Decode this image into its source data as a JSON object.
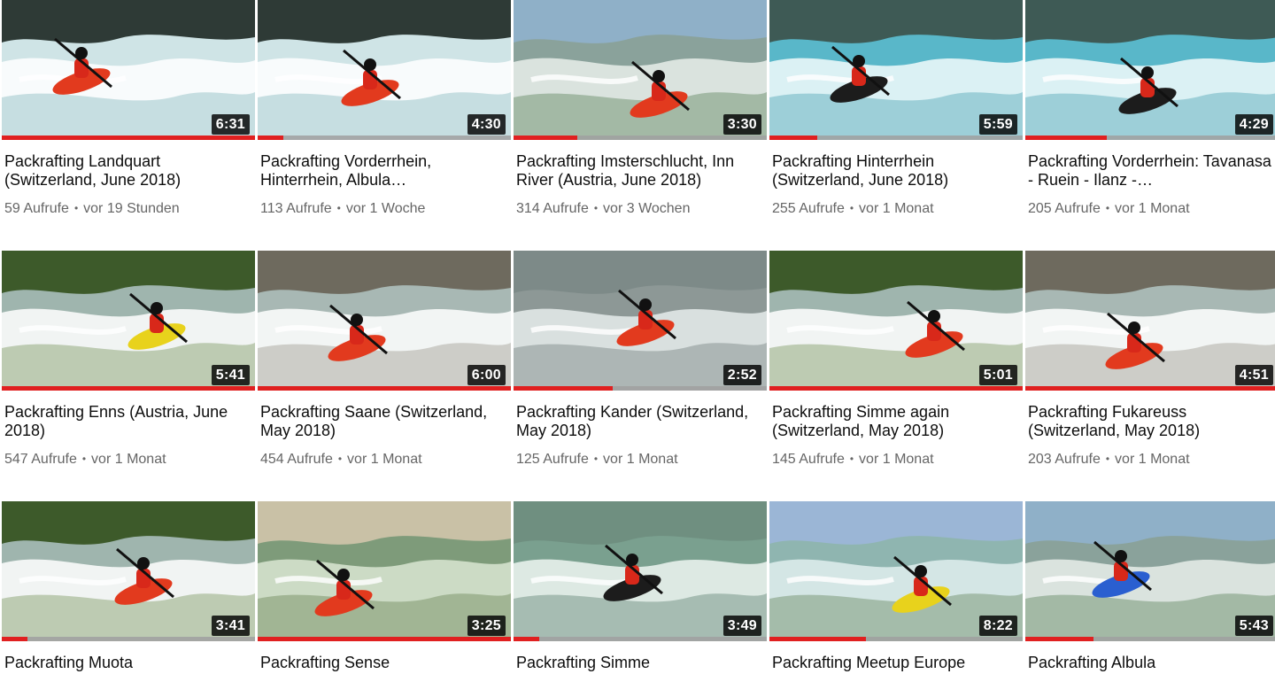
{
  "colors": {
    "progress": "#e02020",
    "track": "#a0a0a0",
    "meta": "#666666",
    "title": "#0d0d0d"
  },
  "videos": [
    {
      "title": "Packrafting Landquart (Switzerland, June 2018)",
      "views": "59 Aufrufe",
      "age": "vor 19 Stunden",
      "duration": "6:31",
      "watched": 1.0,
      "scene": "white",
      "boat": "red"
    },
    {
      "title": "Packrafting Vorderrhein, Hinterrhein, Albula…",
      "views": "113 Aufrufe",
      "age": "vor 1 Woche",
      "duration": "4:30",
      "watched": 0.1,
      "scene": "white",
      "boat": "red"
    },
    {
      "title": "Packrafting Imsterschlucht, Inn River (Austria, June 2018)",
      "views": "314 Aufrufe",
      "age": "vor 3 Wochen",
      "duration": "3:30",
      "watched": 0.25,
      "scene": "valley",
      "boat": "red"
    },
    {
      "title": "Packrafting Hinterrhein (Switzerland, June 2018)",
      "views": "255 Aufrufe",
      "age": "vor 1 Monat",
      "duration": "5:59",
      "watched": 0.19,
      "scene": "turquoise",
      "boat": "black"
    },
    {
      "title": "Packrafting Vorderrhein: Tavanasa - Ruein - Ilanz -…",
      "views": "205 Aufrufe",
      "age": "vor 1 Monat",
      "duration": "4:29",
      "watched": 0.32,
      "scene": "turquoise",
      "boat": "black"
    },
    {
      "title": "Packrafting Enns (Austria, June 2018)",
      "views": "547 Aufrufe",
      "age": "vor 1 Monat",
      "duration": "5:41",
      "watched": 1.0,
      "scene": "forest",
      "boat": "yellow"
    },
    {
      "title": "Packrafting Saane (Switzerland, May 2018)",
      "views": "454 Aufrufe",
      "age": "vor 1 Monat",
      "duration": "6:00",
      "watched": 1.0,
      "scene": "rock",
      "boat": "red"
    },
    {
      "title": "Packrafting Kander (Switzerland, May 2018)",
      "views": "125 Aufrufe",
      "age": "vor 1 Monat",
      "duration": "2:52",
      "watched": 0.39,
      "scene": "grey",
      "boat": "red"
    },
    {
      "title": "Packrafting Simme again (Switzerland, May 2018)",
      "views": "145 Aufrufe",
      "age": "vor 1 Monat",
      "duration": "5:01",
      "watched": 1.0,
      "scene": "forest",
      "boat": "red"
    },
    {
      "title": "Packrafting Fukareuss (Switzerland, May 2018)",
      "views": "203 Aufrufe",
      "age": "vor 1 Monat",
      "duration": "4:51",
      "watched": 1.0,
      "scene": "rock",
      "boat": "red"
    },
    {
      "title": "Packrafting Muota",
      "views": "",
      "age": "",
      "duration": "3:41",
      "watched": 0.1,
      "scene": "forest",
      "boat": "red"
    },
    {
      "title": "Packrafting Sense",
      "views": "",
      "age": "",
      "duration": "3:25",
      "watched": 1.0,
      "scene": "canyon",
      "boat": "red"
    },
    {
      "title": "Packrafting Simme",
      "views": "",
      "age": "",
      "duration": "3:49",
      "watched": 0.1,
      "scene": "green",
      "boat": "black"
    },
    {
      "title": "Packrafting Meetup Europe",
      "views": "",
      "age": "",
      "duration": "8:22",
      "watched": 0.38,
      "scene": "mountain",
      "boat": "yellow"
    },
    {
      "title": "Packrafting Albula",
      "views": "",
      "age": "",
      "duration": "5:43",
      "watched": 0.27,
      "scene": "valley",
      "boat": "blue"
    }
  ]
}
